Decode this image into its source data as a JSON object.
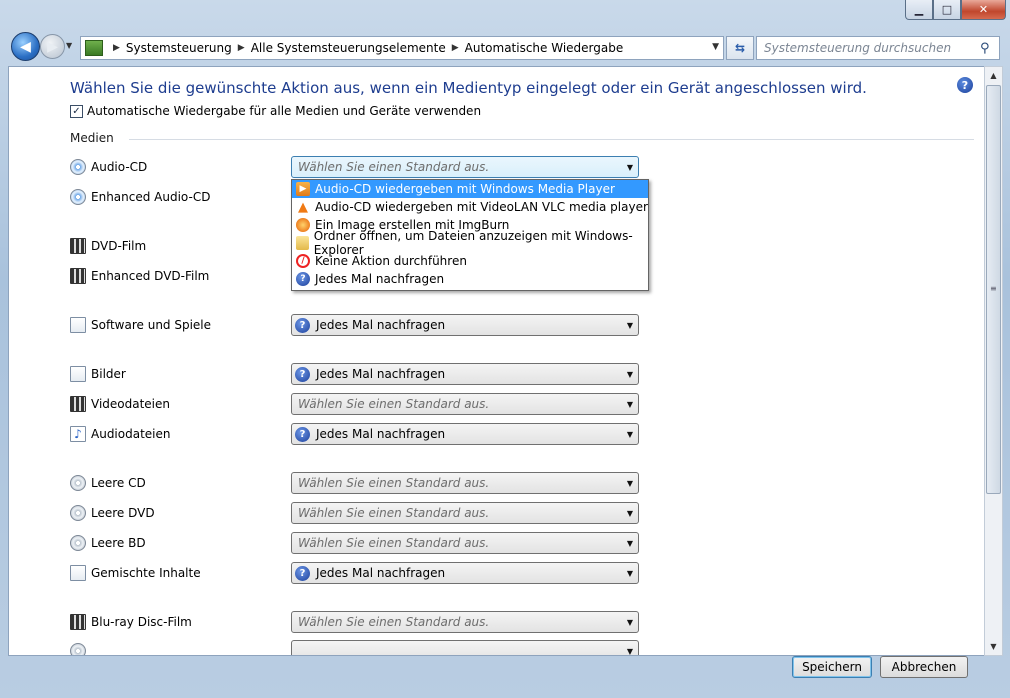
{
  "window": {
    "minimize_glyph": "▁",
    "maximize_glyph": "□",
    "close_glyph": "✕"
  },
  "nav": {
    "back_glyph": "◀",
    "forward_glyph": "▶",
    "breadcrumbs": [
      "Systemsteuerung",
      "Alle Systemsteuerungselemente",
      "Automatische Wiedergabe"
    ],
    "search_placeholder": "Systemsteuerung durchsuchen"
  },
  "main": {
    "heading": "Wählen Sie die gewünschte Aktion aus, wenn ein Medientyp eingelegt oder ein Gerät angeschlossen wird.",
    "autoplay_checkbox_label": "Automatische Wiedergabe für alle Medien und Geräte verwenden",
    "autoplay_checked": true,
    "section_label": "Medien",
    "placeholder": "Wählen Sie einen Standard aus.",
    "rows": [
      {
        "label": "Audio-CD",
        "value": "",
        "icon": "cd-icon"
      },
      {
        "label": "Enhanced Audio-CD",
        "value": "",
        "icon": "cd-icon"
      },
      {
        "label": "DVD-Film",
        "value": "",
        "icon": "dvd-icon"
      },
      {
        "label": "Enhanced DVD-Film",
        "value": "",
        "icon": "dvd-icon"
      },
      {
        "label": "Software und Spiele",
        "value": "Jedes Mal nachfragen",
        "icon": "software-icon"
      },
      {
        "label": "Bilder",
        "value": "Jedes Mal nachfragen",
        "icon": "image-file-icon"
      },
      {
        "label": "Videodateien",
        "value": "",
        "icon": "video-file-icon"
      },
      {
        "label": "Audiodateien",
        "value": "Jedes Mal nachfragen",
        "icon": "audio-file-icon"
      },
      {
        "label": "Leere CD",
        "value": "",
        "icon": "blank-cd-icon"
      },
      {
        "label": "Leere DVD",
        "value": "",
        "icon": "blank-dvd-icon"
      },
      {
        "label": "Leere BD",
        "value": "",
        "icon": "blank-bd-icon"
      },
      {
        "label": "Gemischte Inhalte",
        "value": "Jedes Mal nachfragen",
        "icon": "mixed-content-icon"
      },
      {
        "label": "Blu-ray Disc-Film",
        "value": "",
        "icon": "bluray-icon"
      }
    ],
    "dropdown_options": [
      {
        "label": "Audio-CD wiedergeben mit Windows Media Player",
        "icon": "wmp-icon",
        "selected": true
      },
      {
        "label": "Audio-CD wiedergeben mit VideoLAN VLC media player",
        "icon": "vlc-icon",
        "selected": false
      },
      {
        "label": "Ein Image erstellen mit ImgBurn",
        "icon": "imgburn-icon",
        "selected": false
      },
      {
        "label": "Ordner öffnen, um Dateien anzuzeigen mit Windows-Explorer",
        "icon": "folder-icon",
        "selected": false
      },
      {
        "label": "Keine Aktion durchführen",
        "icon": "no-action-icon",
        "selected": false
      },
      {
        "label": "Jedes Mal nachfragen",
        "icon": "ask-icon",
        "selected": false
      }
    ]
  },
  "footer": {
    "save_label": "Speichern",
    "cancel_label": "Abbrechen"
  },
  "colors": {
    "heading": "#1e3d8f",
    "selection": "#3399ff"
  }
}
